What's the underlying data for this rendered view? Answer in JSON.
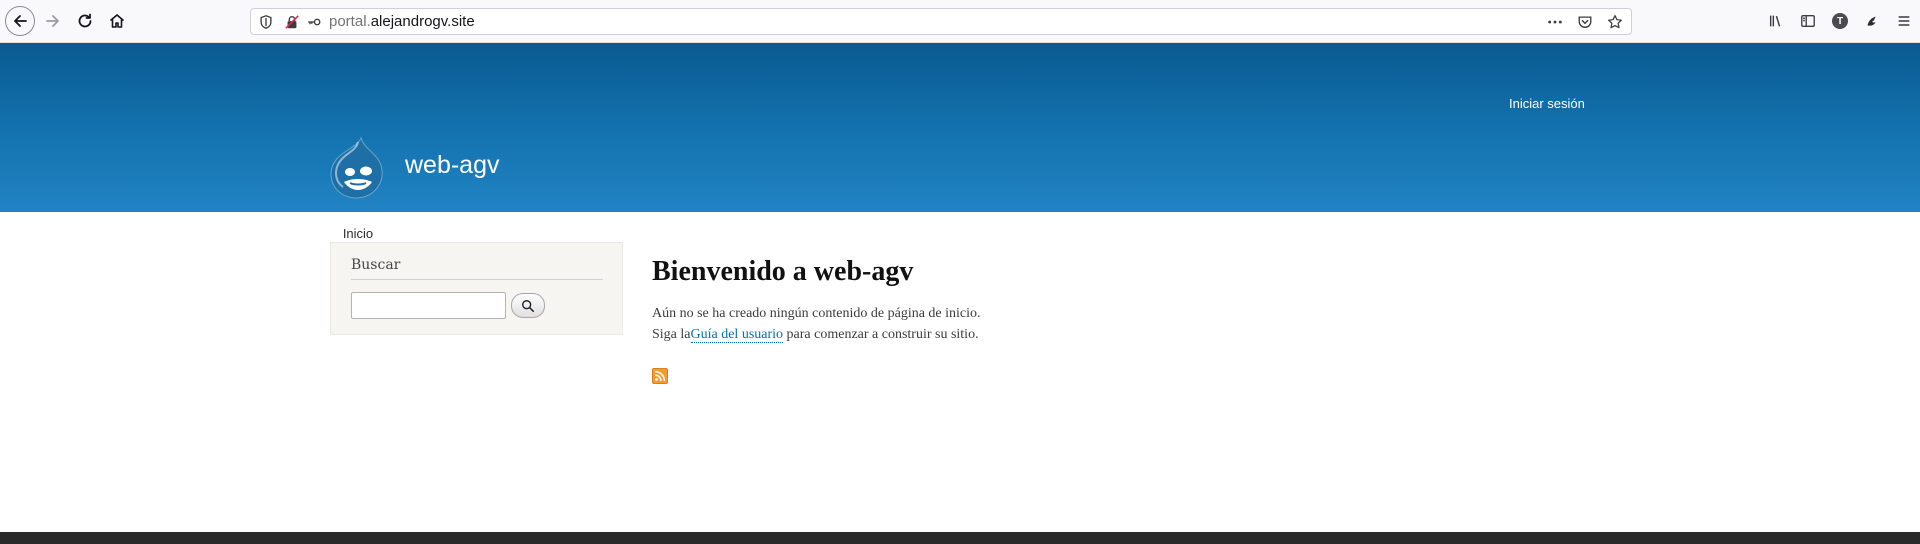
{
  "browser": {
    "url_prefix": "portal.",
    "url_host": "alejandrogv.site",
    "profile_initial": "T"
  },
  "site": {
    "login_link": "Iniciar sesión",
    "name": "web-agv",
    "nav": {
      "home_tab": "Inicio"
    }
  },
  "sidebar": {
    "search_title": "Buscar",
    "search_value": ""
  },
  "main": {
    "title": "Bienvenido a web-agv",
    "line1": "Aún no se ha creado ningún contenido de página de inicio.",
    "line2_before": "Siga la",
    "line2_link": "Guía del usuario",
    "line2_after": " para comenzar a construir su sitio."
  },
  "colors": {
    "header_top": "#0a5a91",
    "header_bottom": "#2283c4",
    "link": "#0071b3",
    "rss": "#f79c2c"
  },
  "icons": [
    "back-arrow-icon",
    "forward-arrow-icon",
    "reload-icon",
    "home-icon",
    "shield-icon",
    "insecure-lock-icon",
    "key-icon",
    "more-actions-icon",
    "pocket-icon",
    "bookmark-star-icon",
    "library-icon",
    "sidebar-icon",
    "extension-icon",
    "menu-icon",
    "search-icon",
    "rss-feed-icon"
  ]
}
